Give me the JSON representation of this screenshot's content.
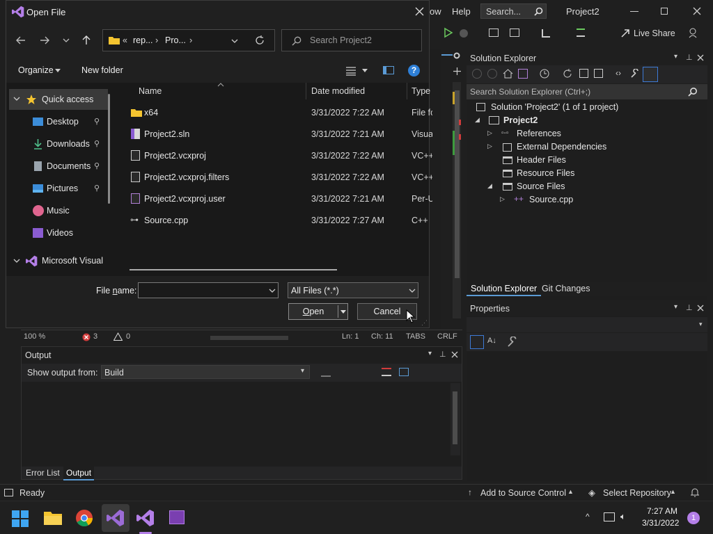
{
  "vs": {
    "menu_visible": [
      "ow",
      "Help"
    ],
    "search_placeholder": "Search...",
    "project_title": "Project2",
    "live_share": "Live Share",
    "editor_status": {
      "zoom": "100 %",
      "errors": "3",
      "warnings": "0",
      "line": "Ln: 1",
      "col": "Ch: 11",
      "tabs": "TABS",
      "eol": "CRLF"
    },
    "output": {
      "title": "Output",
      "show_from_label": "Show output from:",
      "source": "Build",
      "tabs": [
        "Error List",
        "Output"
      ]
    },
    "solution_explorer": {
      "title": "Solution Explorer",
      "search_placeholder": "Search Solution Explorer (Ctrl+;)",
      "solution": "Solution 'Project2' (1 of 1 project)",
      "project": "Project2",
      "nodes": [
        "References",
        "External Dependencies",
        "Header Files",
        "Resource Files",
        "Source Files"
      ],
      "source_child": "Source.cpp",
      "tabs": [
        "Solution Explorer",
        "Git Changes"
      ]
    },
    "properties_title": "Properties",
    "statusbar": {
      "ready": "Ready",
      "add_source": "Add to Source Control",
      "select_repo": "Select Repository"
    }
  },
  "dialog": {
    "title": "Open File",
    "breadcrumb": [
      "«",
      "rep...",
      "›",
      "Pro...",
      "›"
    ],
    "search_placeholder": "Search Project2",
    "organize": "Organize",
    "new_folder": "New folder",
    "sidebar": [
      "Quick access",
      "Desktop",
      "Downloads",
      "Documents",
      "Pictures",
      "Music",
      "Videos",
      "Microsoft Visual"
    ],
    "columns": [
      "Name",
      "Date modified",
      "Type"
    ],
    "files": [
      {
        "name": "x64",
        "date": "3/31/2022 7:22 AM",
        "type": "File fo"
      },
      {
        "name": "Project2.sln",
        "date": "3/31/2022 7:21 AM",
        "type": "Visua"
      },
      {
        "name": "Project2.vcxproj",
        "date": "3/31/2022 7:22 AM",
        "type": "VC++"
      },
      {
        "name": "Project2.vcxproj.filters",
        "date": "3/31/2022 7:22 AM",
        "type": "VC++"
      },
      {
        "name": "Project2.vcxproj.user",
        "date": "3/31/2022 7:21 AM",
        "type": "Per-U"
      },
      {
        "name": "Source.cpp",
        "date": "3/31/2022 7:27 AM",
        "type": "C++"
      }
    ],
    "file_name_label_pre": "File ",
    "file_name_label_u": "n",
    "file_name_label_post": "ame:",
    "file_name_value": "",
    "filter": "All Files (*.*)",
    "open_u": "O",
    "open_rest": "pen",
    "cancel": "Cancel"
  },
  "taskbar": {
    "time": "7:27 AM",
    "date": "3/31/2022",
    "notifications": "1"
  }
}
